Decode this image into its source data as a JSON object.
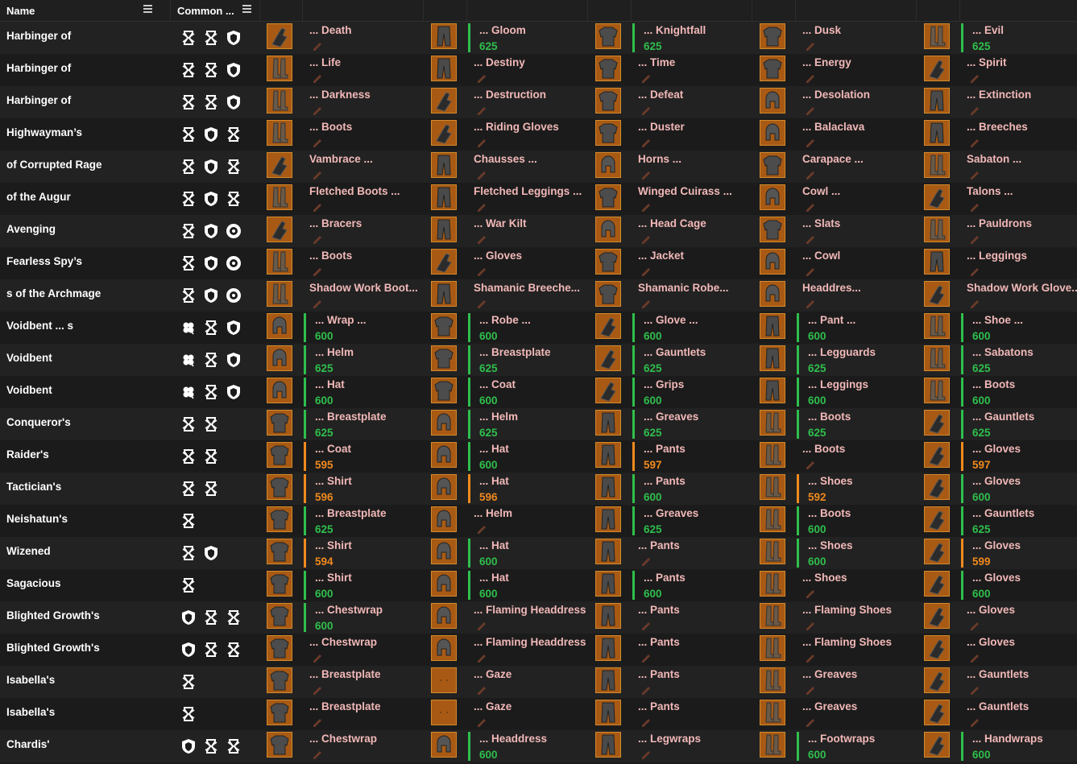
{
  "header": {
    "col_name": "Name",
    "col_perks": "Common ..."
  },
  "colors": {
    "green": "#2fbf4c",
    "orange": "#f08a1e",
    "item_name": "#f2b8b8",
    "thumb_border": "#d38a2c"
  },
  "rows": [
    {
      "name": "Harbinger of",
      "perks": [
        "hourglass-icon",
        "hourglass-icon",
        "shield-icon"
      ],
      "items": [
        {
          "name": "... Death",
          "power": "",
          "tier": "none",
          "thumb": "glove"
        },
        {
          "name": "... Gloom",
          "power": "625",
          "tier": "green",
          "thumb": "pants"
        },
        {
          "name": "... Knightfall",
          "power": "625",
          "tier": "green",
          "thumb": "chest"
        },
        {
          "name": "... Dusk",
          "power": "",
          "tier": "none",
          "thumb": "chest"
        },
        {
          "name": "... Evil",
          "power": "625",
          "tier": "green",
          "thumb": "boots"
        }
      ]
    },
    {
      "name": "Harbinger of",
      "perks": [
        "hourglass-icon",
        "hourglass-icon",
        "shield-icon"
      ],
      "items": [
        {
          "name": "... Life",
          "power": "",
          "tier": "none",
          "thumb": "boots"
        },
        {
          "name": "... Destiny",
          "power": "",
          "tier": "none",
          "thumb": "pants"
        },
        {
          "name": "... Time",
          "power": "",
          "tier": "none",
          "thumb": "chest"
        },
        {
          "name": "... Energy",
          "power": "",
          "tier": "none",
          "thumb": "chest"
        },
        {
          "name": "... Spirit",
          "power": "",
          "tier": "none",
          "thumb": "glove"
        }
      ]
    },
    {
      "name": "Harbinger of",
      "perks": [
        "hourglass-icon",
        "hourglass-icon",
        "shield-icon"
      ],
      "items": [
        {
          "name": "... Darkness",
          "power": "",
          "tier": "none",
          "thumb": "boots"
        },
        {
          "name": "... Destruction",
          "power": "",
          "tier": "none",
          "thumb": "glove"
        },
        {
          "name": "... Defeat",
          "power": "",
          "tier": "none",
          "thumb": "chest"
        },
        {
          "name": "... Desolation",
          "power": "",
          "tier": "none",
          "thumb": "helm"
        },
        {
          "name": "... Extinction",
          "power": "",
          "tier": "none",
          "thumb": "pants"
        }
      ]
    },
    {
      "name": "Highwayman’s",
      "perks": [
        "hourglass-icon",
        "shield-icon",
        "hourglass-icon"
      ],
      "items": [
        {
          "name": "... Boots",
          "power": "",
          "tier": "none",
          "thumb": "boots"
        },
        {
          "name": "... Riding Gloves",
          "power": "",
          "tier": "none",
          "thumb": "glove"
        },
        {
          "name": "... Duster",
          "power": "",
          "tier": "none",
          "thumb": "chest"
        },
        {
          "name": "... Balaclava",
          "power": "",
          "tier": "none",
          "thumb": "helm"
        },
        {
          "name": "... Breeches",
          "power": "",
          "tier": "none",
          "thumb": "pants"
        }
      ]
    },
    {
      "name": "of Corrupted Rage",
      "perks": [
        "hourglass-icon",
        "shield-icon",
        "hourglass-icon"
      ],
      "items": [
        {
          "name": "Vambrace ...",
          "power": "",
          "tier": "none",
          "thumb": "glove"
        },
        {
          "name": "Chausses ...",
          "power": "",
          "tier": "none",
          "thumb": "pants"
        },
        {
          "name": "Horns ...",
          "power": "",
          "tier": "none",
          "thumb": "helm"
        },
        {
          "name": "Carapace ...",
          "power": "",
          "tier": "none",
          "thumb": "chest"
        },
        {
          "name": "Sabaton ...",
          "power": "",
          "tier": "none",
          "thumb": "boots"
        }
      ]
    },
    {
      "name": "of the Augur",
      "perks": [
        "hourglass-icon",
        "shield-icon",
        "hourglass-icon"
      ],
      "items": [
        {
          "name": "Fletched Boots ...",
          "power": "",
          "tier": "none",
          "thumb": "boots"
        },
        {
          "name": "Fletched Leggings ...",
          "power": "",
          "tier": "none",
          "thumb": "pants"
        },
        {
          "name": "Winged Cuirass ...",
          "power": "",
          "tier": "none",
          "thumb": "chest"
        },
        {
          "name": "Cowl ...",
          "power": "",
          "tier": "none",
          "thumb": "helm"
        },
        {
          "name": "Talons ...",
          "power": "",
          "tier": "none",
          "thumb": "glove"
        }
      ]
    },
    {
      "name": "Avenging",
      "perks": [
        "hourglass-icon",
        "shield-icon",
        "eye-icon"
      ],
      "items": [
        {
          "name": "... Bracers",
          "power": "",
          "tier": "none",
          "thumb": "glove"
        },
        {
          "name": "... War Kilt",
          "power": "",
          "tier": "none",
          "thumb": "pants"
        },
        {
          "name": "... Head Cage",
          "power": "",
          "tier": "none",
          "thumb": "helm"
        },
        {
          "name": "... Slats",
          "power": "",
          "tier": "none",
          "thumb": "chest"
        },
        {
          "name": "... Pauldrons",
          "power": "",
          "tier": "none",
          "thumb": "boots"
        }
      ]
    },
    {
      "name": "Fearless Spy’s",
      "perks": [
        "hourglass-icon",
        "shield-icon",
        "eye-icon"
      ],
      "items": [
        {
          "name": "... Boots",
          "power": "",
          "tier": "none",
          "thumb": "boots"
        },
        {
          "name": "... Gloves",
          "power": "",
          "tier": "none",
          "thumb": "glove"
        },
        {
          "name": "... Jacket",
          "power": "",
          "tier": "none",
          "thumb": "chest"
        },
        {
          "name": "... Cowl",
          "power": "",
          "tier": "none",
          "thumb": "helm"
        },
        {
          "name": "... Leggings",
          "power": "",
          "tier": "none",
          "thumb": "pants"
        }
      ]
    },
    {
      "name": "s of the Archmage",
      "perks": [
        "hourglass-icon",
        "shield-icon",
        "eye-icon"
      ],
      "items": [
        {
          "name": "Shadow Work Boot...",
          "power": "",
          "tier": "none",
          "thumb": "boots"
        },
        {
          "name": "Shamanic Breeche...",
          "power": "",
          "tier": "none",
          "thumb": "pants"
        },
        {
          "name": "Shamanic Robe...",
          "power": "",
          "tier": "none",
          "thumb": "chest"
        },
        {
          "name": "Headdres...",
          "power": "",
          "tier": "none",
          "thumb": "helm"
        },
        {
          "name": "Shadow Work Glove...",
          "power": "",
          "tier": "none",
          "thumb": "glove"
        }
      ]
    },
    {
      "name": "Voidbent ... s",
      "perks": [
        "clover-icon",
        "hourglass-icon",
        "shield-icon"
      ],
      "items": [
        {
          "name": "... Wrap ...",
          "power": "600",
          "tier": "green",
          "thumb": "helm"
        },
        {
          "name": "... Robe ...",
          "power": "600",
          "tier": "green",
          "thumb": "chest"
        },
        {
          "name": "... Glove ...",
          "power": "600",
          "tier": "green",
          "thumb": "glove"
        },
        {
          "name": "... Pant ...",
          "power": "600",
          "tier": "green",
          "thumb": "pants"
        },
        {
          "name": "... Shoe ...",
          "power": "600",
          "tier": "green",
          "thumb": "boots"
        }
      ]
    },
    {
      "name": "Voidbent",
      "perks": [
        "clover-icon",
        "hourglass-icon",
        "shield-icon"
      ],
      "items": [
        {
          "name": "... Helm",
          "power": "625",
          "tier": "green",
          "thumb": "helm"
        },
        {
          "name": "... Breastplate",
          "power": "625",
          "tier": "green",
          "thumb": "chest"
        },
        {
          "name": "... Gauntlets",
          "power": "625",
          "tier": "green",
          "thumb": "glove"
        },
        {
          "name": "... Legguards",
          "power": "625",
          "tier": "green",
          "thumb": "pants"
        },
        {
          "name": "... Sabatons",
          "power": "625",
          "tier": "green",
          "thumb": "boots"
        }
      ]
    },
    {
      "name": "Voidbent",
      "perks": [
        "clover-icon",
        "hourglass-icon",
        "shield-icon"
      ],
      "items": [
        {
          "name": "... Hat",
          "power": "600",
          "tier": "green",
          "thumb": "helm"
        },
        {
          "name": "... Coat",
          "power": "600",
          "tier": "green",
          "thumb": "chest"
        },
        {
          "name": "... Grips",
          "power": "600",
          "tier": "green",
          "thumb": "glove"
        },
        {
          "name": "... Leggings",
          "power": "600",
          "tier": "green",
          "thumb": "pants"
        },
        {
          "name": "... Boots",
          "power": "600",
          "tier": "green",
          "thumb": "boots"
        }
      ]
    },
    {
      "name": "Conqueror's",
      "perks": [
        "hourglass-icon",
        "hourglass-icon"
      ],
      "items": [
        {
          "name": "... Breastplate",
          "power": "625",
          "tier": "green",
          "thumb": "chest"
        },
        {
          "name": "... Helm",
          "power": "625",
          "tier": "green",
          "thumb": "helm"
        },
        {
          "name": "... Greaves",
          "power": "625",
          "tier": "green",
          "thumb": "pants"
        },
        {
          "name": "... Boots",
          "power": "625",
          "tier": "green",
          "thumb": "boots"
        },
        {
          "name": "... Gauntlets",
          "power": "625",
          "tier": "green",
          "thumb": "glove"
        }
      ]
    },
    {
      "name": "Raider's",
      "perks": [
        "hourglass-icon",
        "hourglass-icon"
      ],
      "items": [
        {
          "name": "... Coat",
          "power": "595",
          "tier": "orange",
          "thumb": "chest"
        },
        {
          "name": "... Hat",
          "power": "600",
          "tier": "green",
          "thumb": "helm"
        },
        {
          "name": "... Pants",
          "power": "597",
          "tier": "orange",
          "thumb": "pants"
        },
        {
          "name": "... Boots",
          "power": "",
          "tier": "none",
          "thumb": "boots"
        },
        {
          "name": "... Gloves",
          "power": "597",
          "tier": "orange",
          "thumb": "glove"
        }
      ]
    },
    {
      "name": "Tactician's",
      "perks": [
        "hourglass-icon",
        "hourglass-icon"
      ],
      "items": [
        {
          "name": "... Shirt",
          "power": "596",
          "tier": "orange",
          "thumb": "chest"
        },
        {
          "name": "... Hat",
          "power": "596",
          "tier": "orange",
          "thumb": "helm"
        },
        {
          "name": "... Pants",
          "power": "600",
          "tier": "green",
          "thumb": "pants"
        },
        {
          "name": "... Shoes",
          "power": "592",
          "tier": "orange",
          "thumb": "boots"
        },
        {
          "name": "... Gloves",
          "power": "600",
          "tier": "green",
          "thumb": "glove"
        }
      ]
    },
    {
      "name": "Neishatun's",
      "perks": [
        "hourglass-icon"
      ],
      "items": [
        {
          "name": "... Breastplate",
          "power": "625",
          "tier": "green",
          "thumb": "chest"
        },
        {
          "name": "... Helm",
          "power": "",
          "tier": "none",
          "thumb": "helm"
        },
        {
          "name": "... Greaves",
          "power": "625",
          "tier": "green",
          "thumb": "pants"
        },
        {
          "name": "... Boots",
          "power": "600",
          "tier": "green",
          "thumb": "boots"
        },
        {
          "name": "... Gauntlets",
          "power": "625",
          "tier": "green",
          "thumb": "glove"
        }
      ]
    },
    {
      "name": "Wizened",
      "perks": [
        "hourglass-icon",
        "shield-icon"
      ],
      "items": [
        {
          "name": "... Shirt",
          "power": "594",
          "tier": "orange",
          "thumb": "chest"
        },
        {
          "name": "... Hat",
          "power": "600",
          "tier": "green",
          "thumb": "helm"
        },
        {
          "name": "... Pants",
          "power": "",
          "tier": "none",
          "thumb": "pants"
        },
        {
          "name": "... Shoes",
          "power": "600",
          "tier": "green",
          "thumb": "boots"
        },
        {
          "name": "... Gloves",
          "power": "599",
          "tier": "orange",
          "thumb": "glove"
        }
      ]
    },
    {
      "name": "Sagacious",
      "perks": [
        "hourglass-icon"
      ],
      "items": [
        {
          "name": "... Shirt",
          "power": "600",
          "tier": "green",
          "thumb": "chest"
        },
        {
          "name": "... Hat",
          "power": "600",
          "tier": "green",
          "thumb": "helm"
        },
        {
          "name": "... Pants",
          "power": "600",
          "tier": "green",
          "thumb": "pants"
        },
        {
          "name": "... Shoes",
          "power": "",
          "tier": "none",
          "thumb": "boots"
        },
        {
          "name": "... Gloves",
          "power": "600",
          "tier": "green",
          "thumb": "glove"
        }
      ]
    },
    {
      "name": "Blighted Growth's",
      "perks": [
        "shield-icon",
        "hourglass-icon",
        "hourglass-icon"
      ],
      "items": [
        {
          "name": "... Chestwrap",
          "power": "600",
          "tier": "green",
          "thumb": "chest"
        },
        {
          "name": "... Flaming Headdress",
          "power": "",
          "tier": "none",
          "thumb": "helm"
        },
        {
          "name": "... Pants",
          "power": "",
          "tier": "none",
          "thumb": "pants"
        },
        {
          "name": "... Flaming Shoes",
          "power": "",
          "tier": "none",
          "thumb": "boots"
        },
        {
          "name": "... Gloves",
          "power": "",
          "tier": "none",
          "thumb": "glove"
        }
      ]
    },
    {
      "name": "Blighted Growth's",
      "perks": [
        "shield-icon",
        "hourglass-icon",
        "hourglass-icon"
      ],
      "items": [
        {
          "name": "... Chestwrap",
          "power": "",
          "tier": "none",
          "thumb": "chest"
        },
        {
          "name": "... Flaming Headdress",
          "power": "",
          "tier": "none",
          "thumb": "helm"
        },
        {
          "name": "... Pants",
          "power": "",
          "tier": "none",
          "thumb": "pants"
        },
        {
          "name": "... Flaming Shoes",
          "power": "",
          "tier": "none",
          "thumb": "boots"
        },
        {
          "name": "... Gloves",
          "power": "",
          "tier": "none",
          "thumb": "glove"
        }
      ]
    },
    {
      "name": "Isabella's",
      "perks": [
        "hourglass-icon"
      ],
      "items": [
        {
          "name": "... Breastplate",
          "power": "",
          "tier": "none",
          "thumb": "chest"
        },
        {
          "name": "... Gaze",
          "power": "",
          "tier": "none",
          "thumb": "blank"
        },
        {
          "name": "... Pants",
          "power": "",
          "tier": "none",
          "thumb": "pants"
        },
        {
          "name": "... Greaves",
          "power": "",
          "tier": "none",
          "thumb": "boots"
        },
        {
          "name": "... Gauntlets",
          "power": "",
          "tier": "none",
          "thumb": "glove"
        }
      ]
    },
    {
      "name": "Isabella's",
      "perks": [
        "hourglass-icon"
      ],
      "items": [
        {
          "name": "... Breastplate",
          "power": "",
          "tier": "none",
          "thumb": "chest"
        },
        {
          "name": "... Gaze",
          "power": "",
          "tier": "none",
          "thumb": "blank"
        },
        {
          "name": "... Pants",
          "power": "",
          "tier": "none",
          "thumb": "pants"
        },
        {
          "name": "... Greaves",
          "power": "",
          "tier": "none",
          "thumb": "boots"
        },
        {
          "name": "... Gauntlets",
          "power": "",
          "tier": "none",
          "thumb": "glove"
        }
      ]
    },
    {
      "name": "Chardis'",
      "perks": [
        "shield-icon",
        "hourglass-icon",
        "hourglass-icon"
      ],
      "items": [
        {
          "name": "... Chestwrap",
          "power": "",
          "tier": "none",
          "thumb": "chest"
        },
        {
          "name": "... Headdress",
          "power": "600",
          "tier": "green",
          "thumb": "helm"
        },
        {
          "name": "... Legwraps",
          "power": "",
          "tier": "none",
          "thumb": "pants"
        },
        {
          "name": "... Footwraps",
          "power": "600",
          "tier": "green",
          "thumb": "boots"
        },
        {
          "name": "... Handwraps",
          "power": "600",
          "tier": "green",
          "thumb": "glove"
        }
      ]
    }
  ]
}
